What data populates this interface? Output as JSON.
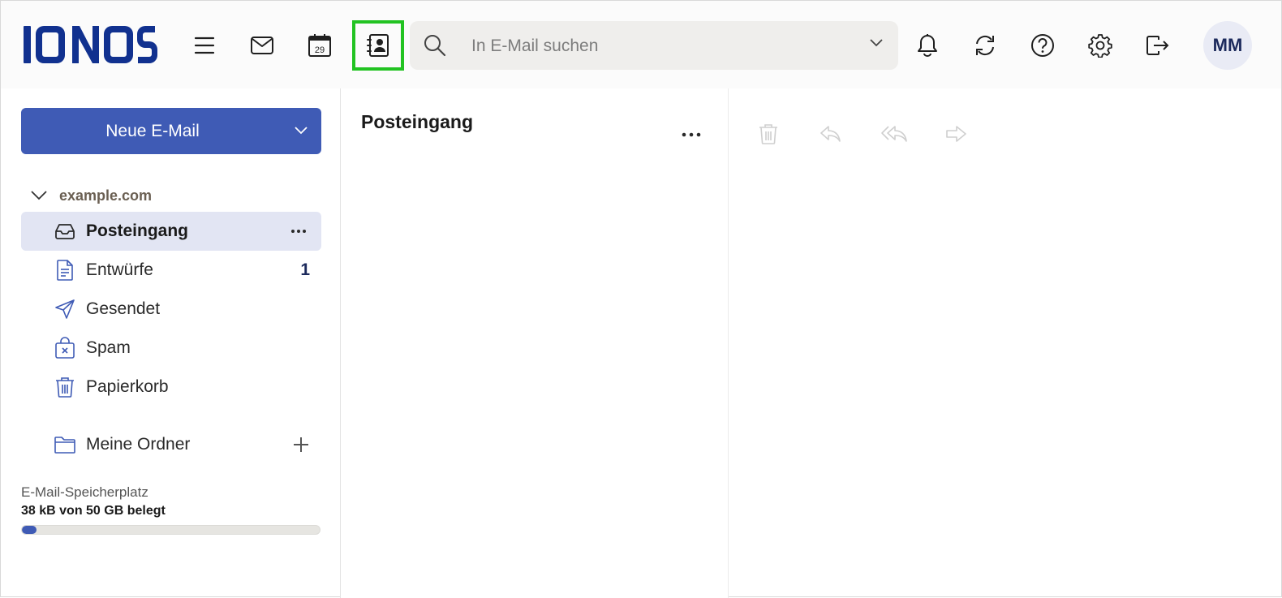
{
  "app": {
    "brand": "IONOS",
    "brand_color": "#11318f",
    "accent": "#3f5bb5",
    "highlight": "#22c322"
  },
  "toolbar": {
    "icons": [
      "menu-icon",
      "mail-icon",
      "calendar-icon",
      "contacts-icon"
    ],
    "calendar_day": "29",
    "highlighted": "contacts-icon"
  },
  "search": {
    "placeholder": "In E-Mail suchen"
  },
  "header_actions": [
    "bell-icon",
    "sync-icon",
    "help-icon",
    "gear-icon",
    "logout-icon"
  ],
  "user": {
    "initials": "MM"
  },
  "compose": {
    "label": "Neue E-Mail"
  },
  "account": {
    "name": "example.com"
  },
  "folders": [
    {
      "label": "Posteingang",
      "icon": "inbox-icon",
      "active": true
    },
    {
      "label": "Entwürfe",
      "icon": "draft-icon",
      "count": "1"
    },
    {
      "label": "Gesendet",
      "icon": "sent-icon"
    },
    {
      "label": "Spam",
      "icon": "spam-icon"
    },
    {
      "label": "Papierkorb",
      "icon": "trash-icon"
    }
  ],
  "my_folders": {
    "label": "Meine Ordner"
  },
  "storage": {
    "label": "E-Mail-Speicherplatz",
    "value": "38 kB von 50 GB belegt",
    "used_fraction": 0.05
  },
  "list": {
    "title": "Posteingang"
  },
  "reading_toolbar": [
    "delete-icon",
    "reply-icon",
    "reply-all-icon",
    "forward-icon"
  ]
}
